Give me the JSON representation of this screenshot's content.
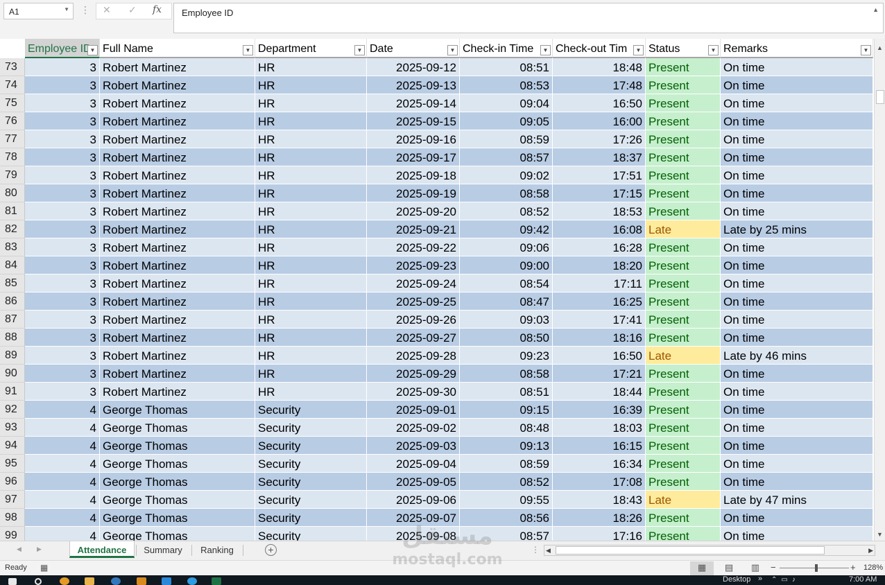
{
  "formula_bar": {
    "name_box": "A1",
    "cancel_icon": "✕",
    "enter_icon": "✓",
    "fx_label": "fx",
    "content": "Employee ID"
  },
  "columns": [
    {
      "label": "Employee ID",
      "key": "id"
    },
    {
      "label": "Full Name",
      "key": "name"
    },
    {
      "label": "Department",
      "key": "dept"
    },
    {
      "label": "Date",
      "key": "date"
    },
    {
      "label": "Check-in Time",
      "key": "in"
    },
    {
      "label": "Check-out Tim",
      "key": "out"
    },
    {
      "label": "Status",
      "key": "status"
    },
    {
      "label": "Remarks",
      "key": "remarks"
    }
  ],
  "rows": [
    {
      "rownum": "73",
      "id": "3",
      "name": "Robert Martinez",
      "dept": "HR",
      "date": "2025-09-12",
      "in": "08:51",
      "out": "18:48",
      "status": "Present",
      "remarks": "On time"
    },
    {
      "rownum": "74",
      "id": "3",
      "name": "Robert Martinez",
      "dept": "HR",
      "date": "2025-09-13",
      "in": "08:53",
      "out": "17:48",
      "status": "Present",
      "remarks": "On time"
    },
    {
      "rownum": "75",
      "id": "3",
      "name": "Robert Martinez",
      "dept": "HR",
      "date": "2025-09-14",
      "in": "09:04",
      "out": "16:50",
      "status": "Present",
      "remarks": "On time"
    },
    {
      "rownum": "76",
      "id": "3",
      "name": "Robert Martinez",
      "dept": "HR",
      "date": "2025-09-15",
      "in": "09:05",
      "out": "16:00",
      "status": "Present",
      "remarks": "On time"
    },
    {
      "rownum": "77",
      "id": "3",
      "name": "Robert Martinez",
      "dept": "HR",
      "date": "2025-09-16",
      "in": "08:59",
      "out": "17:26",
      "status": "Present",
      "remarks": "On time"
    },
    {
      "rownum": "78",
      "id": "3",
      "name": "Robert Martinez",
      "dept": "HR",
      "date": "2025-09-17",
      "in": "08:57",
      "out": "18:37",
      "status": "Present",
      "remarks": "On time"
    },
    {
      "rownum": "79",
      "id": "3",
      "name": "Robert Martinez",
      "dept": "HR",
      "date": "2025-09-18",
      "in": "09:02",
      "out": "17:51",
      "status": "Present",
      "remarks": "On time"
    },
    {
      "rownum": "80",
      "id": "3",
      "name": "Robert Martinez",
      "dept": "HR",
      "date": "2025-09-19",
      "in": "08:58",
      "out": "17:15",
      "status": "Present",
      "remarks": "On time"
    },
    {
      "rownum": "81",
      "id": "3",
      "name": "Robert Martinez",
      "dept": "HR",
      "date": "2025-09-20",
      "in": "08:52",
      "out": "18:53",
      "status": "Present",
      "remarks": "On time"
    },
    {
      "rownum": "82",
      "id": "3",
      "name": "Robert Martinez",
      "dept": "HR",
      "date": "2025-09-21",
      "in": "09:42",
      "out": "16:08",
      "status": "Late",
      "remarks": "Late by 25 mins"
    },
    {
      "rownum": "83",
      "id": "3",
      "name": "Robert Martinez",
      "dept": "HR",
      "date": "2025-09-22",
      "in": "09:06",
      "out": "16:28",
      "status": "Present",
      "remarks": "On time"
    },
    {
      "rownum": "84",
      "id": "3",
      "name": "Robert Martinez",
      "dept": "HR",
      "date": "2025-09-23",
      "in": "09:00",
      "out": "18:20",
      "status": "Present",
      "remarks": "On time"
    },
    {
      "rownum": "85",
      "id": "3",
      "name": "Robert Martinez",
      "dept": "HR",
      "date": "2025-09-24",
      "in": "08:54",
      "out": "17:11",
      "status": "Present",
      "remarks": "On time"
    },
    {
      "rownum": "86",
      "id": "3",
      "name": "Robert Martinez",
      "dept": "HR",
      "date": "2025-09-25",
      "in": "08:47",
      "out": "16:25",
      "status": "Present",
      "remarks": "On time"
    },
    {
      "rownum": "87",
      "id": "3",
      "name": "Robert Martinez",
      "dept": "HR",
      "date": "2025-09-26",
      "in": "09:03",
      "out": "17:41",
      "status": "Present",
      "remarks": "On time"
    },
    {
      "rownum": "88",
      "id": "3",
      "name": "Robert Martinez",
      "dept": "HR",
      "date": "2025-09-27",
      "in": "08:50",
      "out": "18:16",
      "status": "Present",
      "remarks": "On time"
    },
    {
      "rownum": "89",
      "id": "3",
      "name": "Robert Martinez",
      "dept": "HR",
      "date": "2025-09-28",
      "in": "09:23",
      "out": "16:50",
      "status": "Late",
      "remarks": "Late by 46 mins"
    },
    {
      "rownum": "90",
      "id": "3",
      "name": "Robert Martinez",
      "dept": "HR",
      "date": "2025-09-29",
      "in": "08:58",
      "out": "17:21",
      "status": "Present",
      "remarks": "On time"
    },
    {
      "rownum": "91",
      "id": "3",
      "name": "Robert Martinez",
      "dept": "HR",
      "date": "2025-09-30",
      "in": "08:51",
      "out": "18:44",
      "status": "Present",
      "remarks": "On time"
    },
    {
      "rownum": "92",
      "id": "4",
      "name": "George Thomas",
      "dept": "Security",
      "date": "2025-09-01",
      "in": "09:15",
      "out": "16:39",
      "status": "Present",
      "remarks": "On time"
    },
    {
      "rownum": "93",
      "id": "4",
      "name": "George Thomas",
      "dept": "Security",
      "date": "2025-09-02",
      "in": "08:48",
      "out": "18:03",
      "status": "Present",
      "remarks": "On time"
    },
    {
      "rownum": "94",
      "id": "4",
      "name": "George Thomas",
      "dept": "Security",
      "date": "2025-09-03",
      "in": "09:13",
      "out": "16:15",
      "status": "Present",
      "remarks": "On time"
    },
    {
      "rownum": "95",
      "id": "4",
      "name": "George Thomas",
      "dept": "Security",
      "date": "2025-09-04",
      "in": "08:59",
      "out": "16:34",
      "status": "Present",
      "remarks": "On time"
    },
    {
      "rownum": "96",
      "id": "4",
      "name": "George Thomas",
      "dept": "Security",
      "date": "2025-09-05",
      "in": "08:52",
      "out": "17:08",
      "status": "Present",
      "remarks": "On time"
    },
    {
      "rownum": "97",
      "id": "4",
      "name": "George Thomas",
      "dept": "Security",
      "date": "2025-09-06",
      "in": "09:55",
      "out": "18:43",
      "status": "Late",
      "remarks": "Late by 47 mins"
    },
    {
      "rownum": "98",
      "id": "4",
      "name": "George Thomas",
      "dept": "Security",
      "date": "2025-09-07",
      "in": "08:56",
      "out": "18:26",
      "status": "Present",
      "remarks": "On time"
    },
    {
      "rownum": "99",
      "id": "4",
      "name": "George Thomas",
      "dept": "Security",
      "date": "2025-09-08",
      "in": "08:57",
      "out": "17:16",
      "status": "Present",
      "remarks": "On time"
    }
  ],
  "sheet_tabs": {
    "active": "Attendance",
    "tab1": "Attendance",
    "tab2": "Summary",
    "tab3": "Ranking",
    "add_icon": "+"
  },
  "status_bar": {
    "ready": "Ready",
    "zoom": "128%"
  },
  "taskbar": {
    "desktop": "Desktop",
    "clock": "7:00 AM"
  },
  "watermark": {
    "arabic": "مستقل",
    "latin": "mostaql.com"
  },
  "colors": {
    "excel_green": "#217346",
    "row_light": "#dce6f1",
    "row_dark": "#b8cce4",
    "present_fill": "#c6efce",
    "late_fill": "#ffeb9c"
  }
}
